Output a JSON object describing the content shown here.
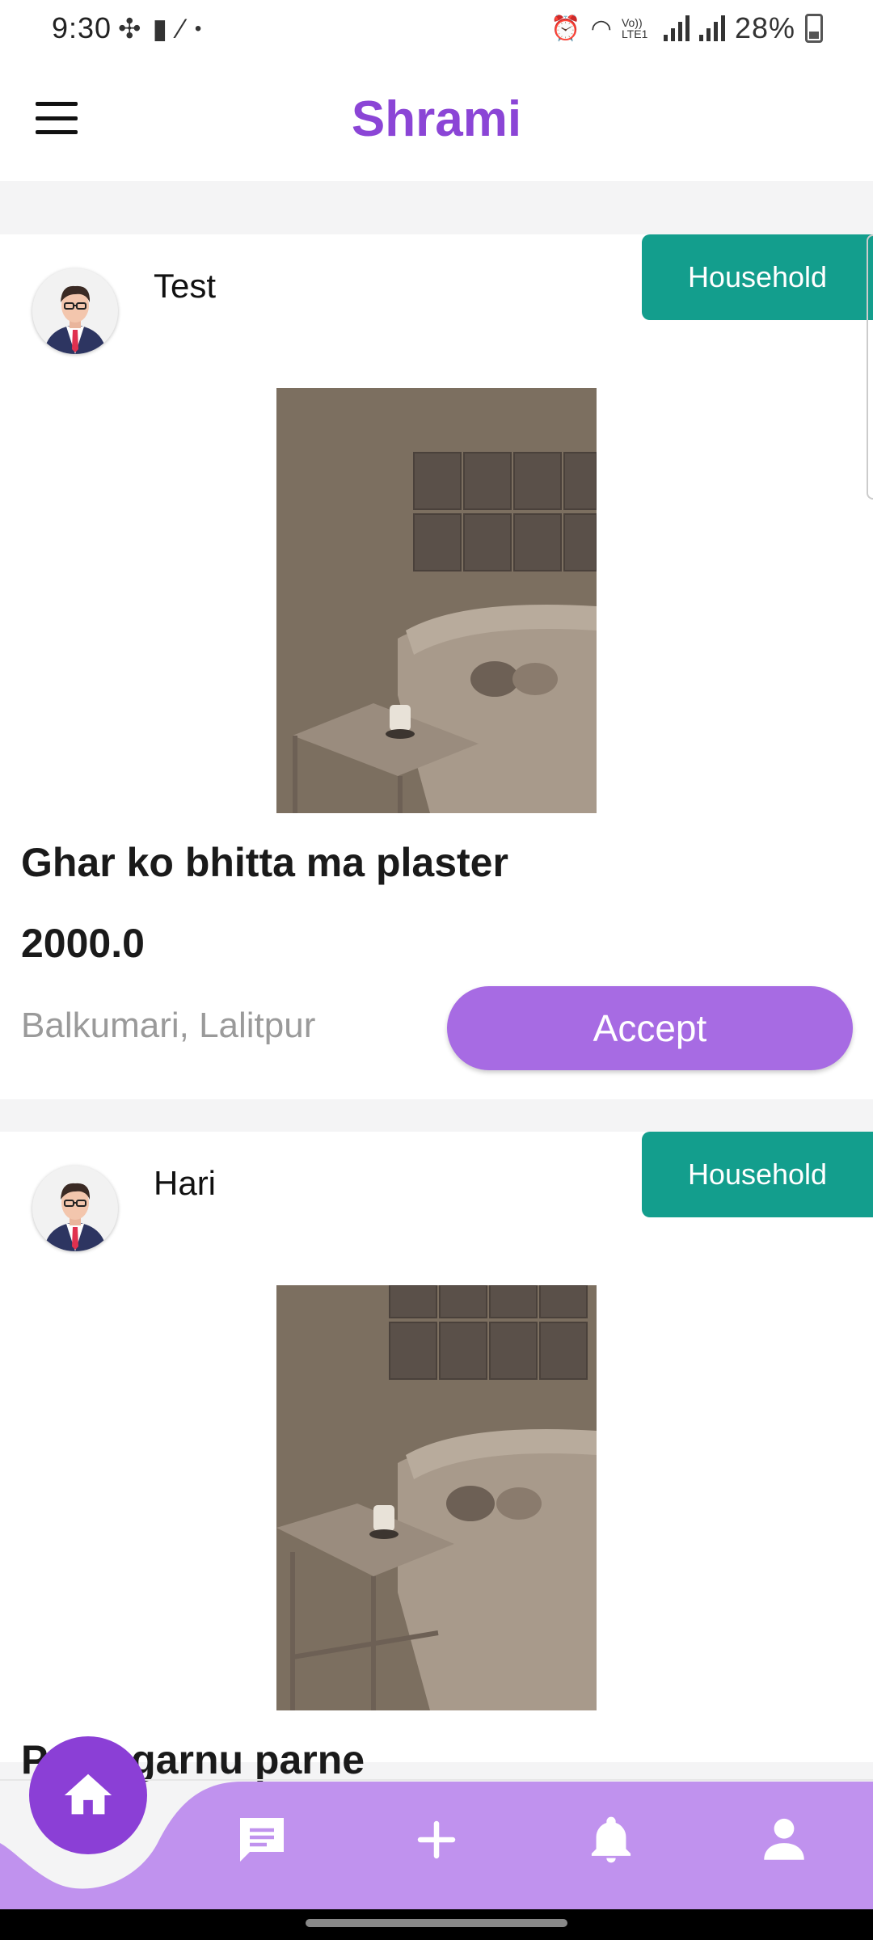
{
  "status": {
    "time": "9:30",
    "battery": "28%",
    "network": "Vo)) LTE1"
  },
  "app": {
    "title": "Shrami"
  },
  "posts": [
    {
      "user": "Test",
      "category": "Household",
      "title": "Ghar ko bhitta ma plaster",
      "price": "2000.0",
      "location": "Balkumari, Lalitpur",
      "action": "Accept"
    },
    {
      "user": "Hari",
      "category": "Household",
      "title": "Paint garnu parne",
      "price": "",
      "location": "",
      "action": ""
    }
  ],
  "nav": {
    "items": [
      "home-icon",
      "chat-icon",
      "add-icon",
      "notification-icon",
      "profile-icon"
    ]
  },
  "colors": {
    "accent": "#8b45d6",
    "badge": "#139e8d",
    "button": "#a76be3",
    "navbar": "#c092ee"
  }
}
